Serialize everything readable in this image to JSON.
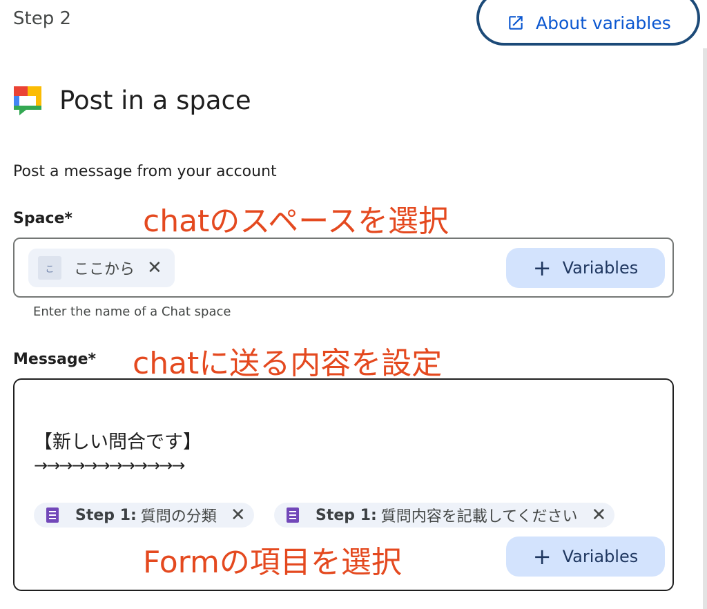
{
  "header": {
    "step_label": "Step 2",
    "about_button": "About variables",
    "about_icon": "open-in-new-icon"
  },
  "action": {
    "icon": "google-chat-icon",
    "title": "Post in a space",
    "description": "Post a message from your account"
  },
  "space_field": {
    "label": "Space*",
    "annotation": "chatのスペースを選択",
    "chip": {
      "avatar": "こ",
      "label": "ここから"
    },
    "variables_button": "Variables",
    "hint": "Enter the name of a Chat space"
  },
  "message_field": {
    "label": "Message*",
    "annotation": "chatに送る内容を設定",
    "line1": "【新しい問合です】",
    "line2": "→→→→→→→→→→→→",
    "chips": [
      {
        "step": "Step 1:",
        "text": "質問の分類"
      },
      {
        "step": "Step 1:",
        "text": "質問内容を記載してください"
      }
    ],
    "form_annotation": "Formの項目を選択",
    "variables_button": "Variables"
  },
  "colors": {
    "annotation": "#e4491f",
    "link": "#0b57d0",
    "variables_bg": "#d3e3fd",
    "chip_bg": "#eef2f9",
    "forms_purple": "#7248b9"
  }
}
